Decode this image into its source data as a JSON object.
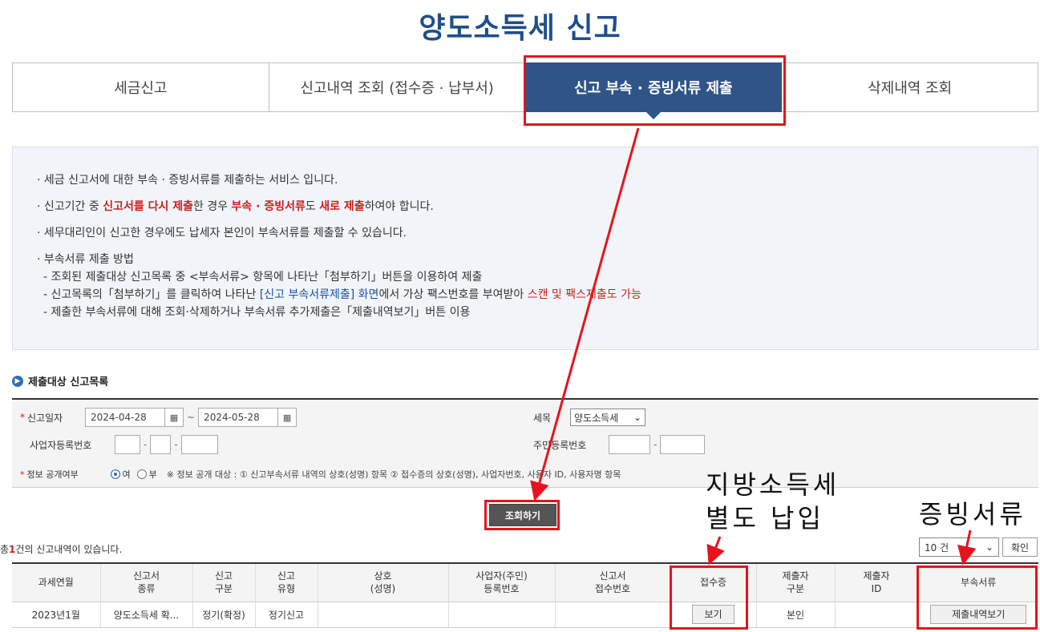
{
  "title": "양도소득세 신고",
  "tabs": [
    "세금신고",
    "신고내역 조회 (접수증 · 납부서)",
    "신고 부속 · 증빙서류 제출",
    "삭제내역 조회"
  ],
  "info": {
    "l1": "· 세금 신고서에 대한 부속 · 증빙서류를 제출하는 서비스 입니다.",
    "l2a": "· 신고기간 중 ",
    "l2b": "신고서를 다시 제출",
    "l2c": "한 경우 ",
    "l2d": "부속 · 증빙서류",
    "l2e": "도 ",
    "l2f": "새로 제출",
    "l2g": "하여야 합니다.",
    "l3": "· 세무대리인이 신고한 경우에도 납세자 본인이 부속서류를 제출할 수 있습니다.",
    "l4": "· 부속서류 제출 방법",
    "s1": "- 조회된 제출대상 신고목록 중 <부속서류> 항목에 나타난「첨부하기」버튼을 이용하여 제출",
    "s2a": "- 신고목록의「첨부하기」를 클릭하여 나타난 ",
    "s2b": "[신고 부속서류제출] 화면",
    "s2c": "에서 가상 팩스번호를 부여받아 ",
    "s2d": "스캔 및 팩스제출도 가능",
    "s3": "- 제출한 부속서류에 대해 조회·삭제하거나 부속서류 추가제출은「제출내역보기」버튼 이용"
  },
  "section_title": "제출대상 신고목록",
  "search": {
    "date_label": "신고일자",
    "date_from": "2024-04-28",
    "date_to": "2024-05-28",
    "tilde": "~",
    "tax_label": "세목",
    "tax_value": "양도소득세",
    "biz_label": "사업자등록번호",
    "rrn_label": "주민등록번호",
    "disclose_label": "정보 공개여부",
    "opt_yes": "여",
    "opt_no": "부",
    "disclose_note": "※ 정보 공개 대상 : ① 신고부속서류 내역의 상호(성명) 항목 ② 접수증의 상호(성명), 사업자번호, 사용자 ID, 사용자명 항목",
    "search_btn": "조회하기"
  },
  "count_prefix": "총",
  "count_num": "1",
  "count_suffix": "건의 신고내역이 있습니다.",
  "page_size": "10 건",
  "ok_btn": "확인",
  "table": {
    "headers": [
      "과세연월",
      "신고서\n종류",
      "신고\n구분",
      "신고\n유형",
      "상호\n(성명)",
      "사업자(주민)\n등록번호",
      "신고서\n접수번호",
      "접수증",
      "제출자\n구분",
      "제출자\nID",
      "부속서류"
    ],
    "row": {
      "period": "2023년1월",
      "form": "양도소득세 확...",
      "div": "정기(확정)",
      "type": "정기신고",
      "name": "",
      "regno": "",
      "receipt_no": "",
      "receipt_btn": "보기",
      "submitter": "본인",
      "submitter_id": "",
      "docs_btn": "제출내역보기"
    }
  },
  "annotations": {
    "local_tax_1": "지방소득세",
    "local_tax_2": "별도 납입",
    "docs": "증빙서류"
  },
  "accent_colors": {
    "highlight": "#e8121c",
    "tab_active": "#2f5488",
    "title": "#1f4e8c"
  }
}
